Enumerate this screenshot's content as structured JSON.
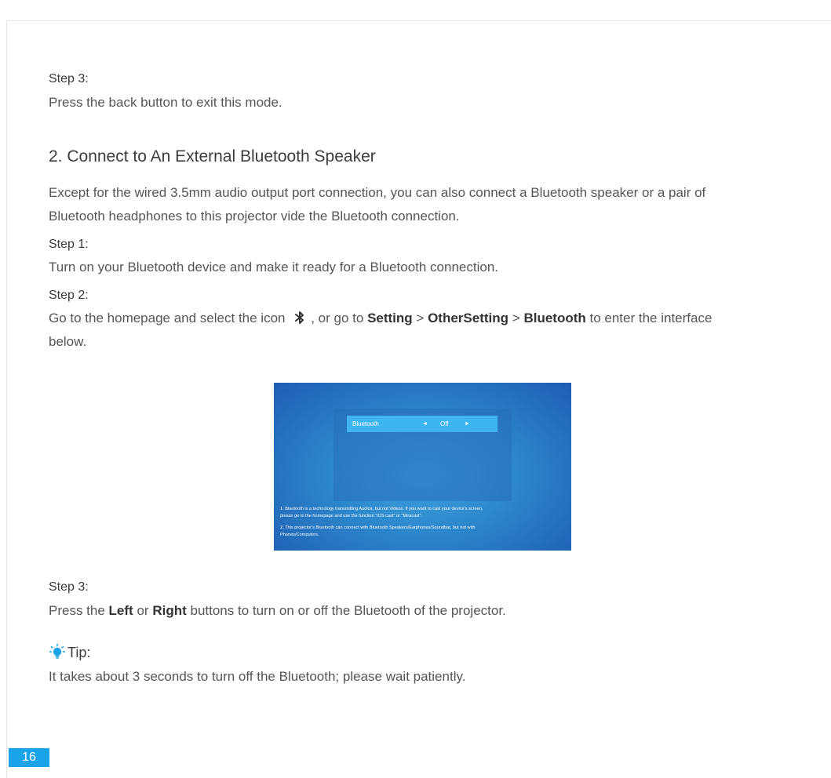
{
  "step3_top": {
    "label": "Step 3:",
    "text": "Press the back button to exit this mode."
  },
  "section": {
    "title": "2. Connect to An External Bluetooth Speaker",
    "intro_line1": "Except for the wired 3.5mm audio output port connection, you can also connect a Bluetooth speaker or a pair of",
    "intro_line2": "Bluetooth headphones to this projector vide the Bluetooth connection."
  },
  "step1": {
    "label": "Step 1:",
    "text": "Turn on your Bluetooth device and make it ready for a Bluetooth connection."
  },
  "step2": {
    "label": "Step 2:",
    "text_a": "Go to the homepage and select the icon",
    "text_b": ", or go to",
    "setting": "Setting",
    "sep1": ">",
    "other": "OtherSetting",
    "sep2": ">",
    "bluetooth": "Bluetooth",
    "text_c": "to enter the interface",
    "text_d": "below."
  },
  "screenshot": {
    "row_label": "Bluetooth",
    "arrow_left": "◄",
    "value": "Off",
    "arrow_right": "►",
    "note1_line1": "1. Bluetooth is a technology transmitting Audios, but not Videos. If you want to cast your device's screen,",
    "note1_line2": "please go to the homepage and use the function \"iOS cast\" or \"Miracast\".",
    "note2_line1": "2. This projector's Bluetooth can connect with Bluetooth Speakers/Earphones/Soundbar, but not with",
    "note2_line2": "Phones/Computers."
  },
  "step3_bottom": {
    "label": "Step 3:",
    "text_a": "Press the",
    "left": "Left",
    "or": "or",
    "right": "Right",
    "text_b": "buttons to turn on or off the Bluetooth of the projector."
  },
  "tip": {
    "label": "Tip:",
    "text": "It takes about 3 seconds to turn off the Bluetooth; please wait patiently."
  },
  "page_number": "16",
  "colors": {
    "accent": "#1aa3e8",
    "bulb": "#1aa3e8"
  },
  "icons": [
    "bluetooth-icon",
    "lightbulb-icon"
  ]
}
